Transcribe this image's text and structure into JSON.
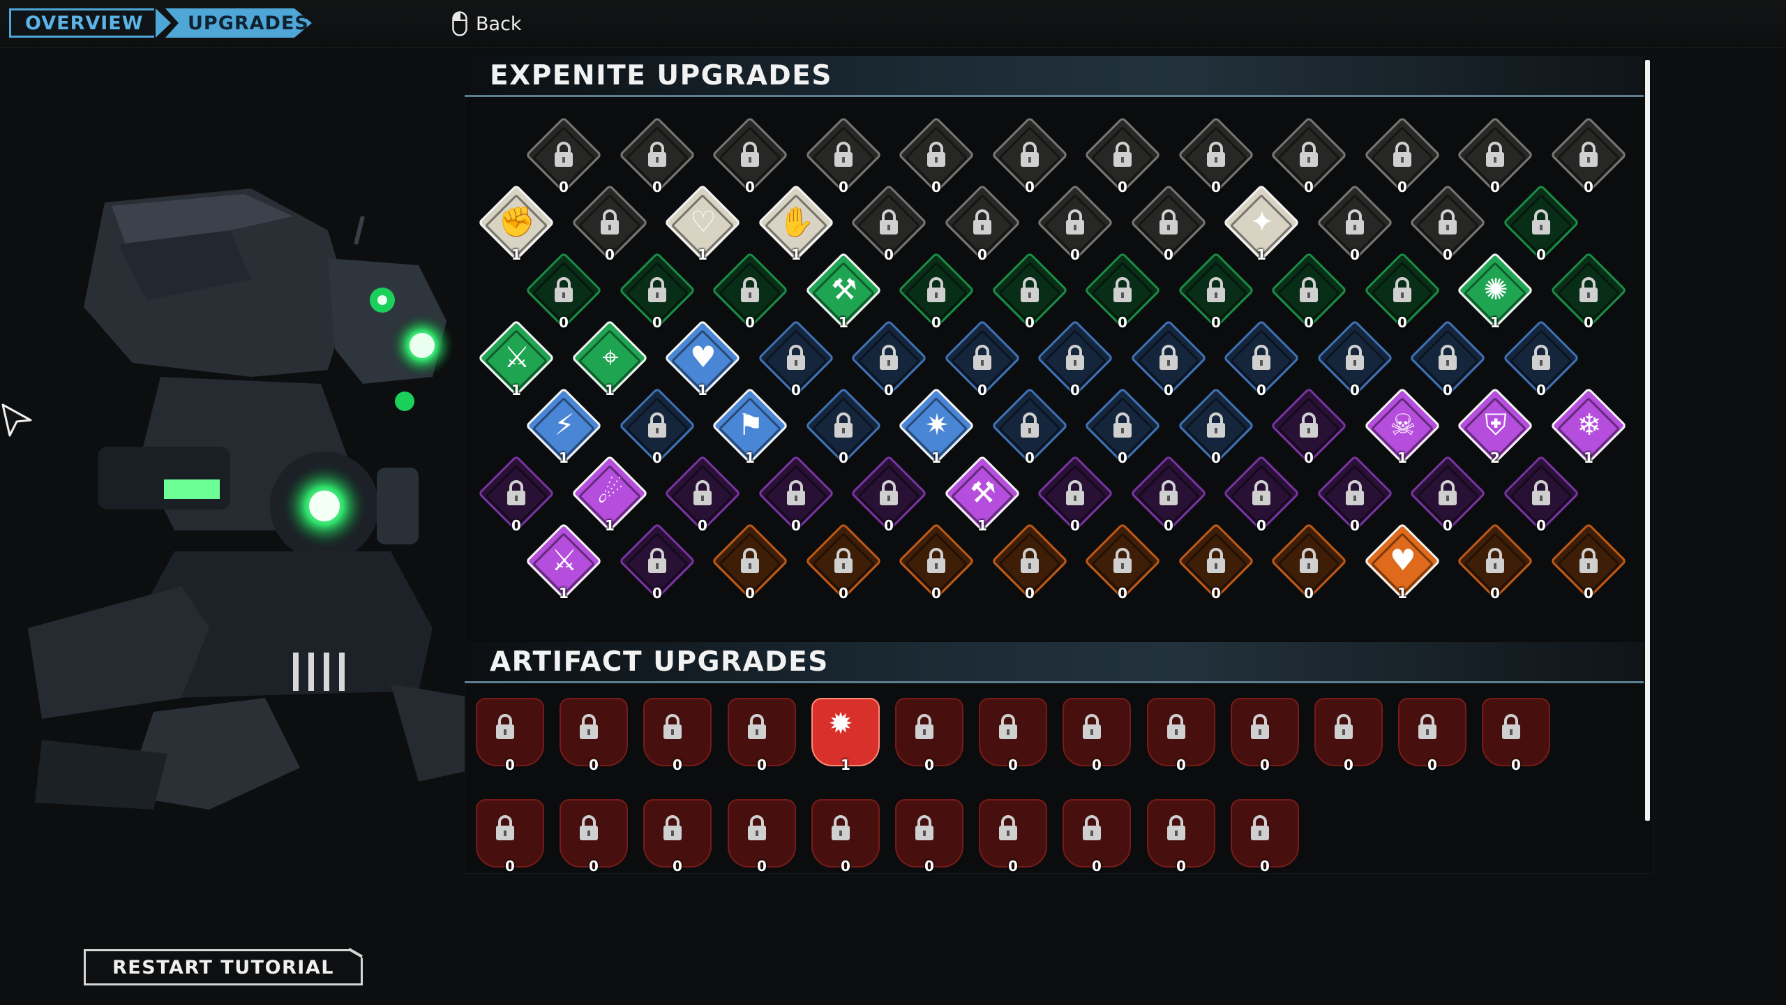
{
  "breadcrumb": {
    "overview": "OVERVIEW",
    "upgrades": "UPGRADES"
  },
  "back": {
    "icon": "mouse-icon",
    "label": "Back"
  },
  "sections": {
    "expenite_title": "EXPENITE UPGRADES",
    "artifact_title": "ARTIFACT UPGRADES"
  },
  "restart_label": "RESTART TUTORIAL",
  "colors": {
    "gray": "#8d8c89",
    "tan": "#d9d3c4",
    "green": "#1fa552",
    "blue": "#4a86d6",
    "purple": "#8e3dbf",
    "purple_bright": "#b54ddd",
    "orange": "#e06a1b",
    "red": "#d8312c"
  },
  "expenite_rows": [
    [
      {
        "c": "gray",
        "n": "0"
      },
      {
        "c": "gray",
        "n": "0"
      },
      {
        "c": "gray",
        "n": "0"
      },
      {
        "c": "gray",
        "n": "0"
      },
      {
        "c": "gray",
        "n": "0"
      },
      {
        "c": "gray",
        "n": "0"
      },
      {
        "c": "gray",
        "n": "0"
      },
      {
        "c": "gray",
        "n": "0"
      },
      {
        "c": "gray",
        "n": "0"
      },
      {
        "c": "gray",
        "n": "0"
      },
      {
        "c": "gray",
        "n": "0"
      },
      {
        "c": "gray",
        "n": "0"
      }
    ],
    [
      {
        "c": "tan",
        "n": "1",
        "on": true,
        "g": "✊"
      },
      {
        "c": "gray",
        "n": "0"
      },
      {
        "c": "tan",
        "n": "1",
        "on": true,
        "g": "♡"
      },
      {
        "c": "tan",
        "n": "1",
        "on": true,
        "g": "✋"
      },
      {
        "c": "gray",
        "n": "0"
      },
      {
        "c": "gray",
        "n": "0"
      },
      {
        "c": "gray",
        "n": "0"
      },
      {
        "c": "gray",
        "n": "0"
      },
      {
        "c": "tan",
        "n": "1",
        "on": true,
        "g": "✦"
      },
      {
        "c": "gray",
        "n": "0"
      },
      {
        "c": "gray",
        "n": "0"
      },
      {
        "c": "green",
        "n": "0"
      }
    ],
    [
      {
        "c": "green",
        "n": "0"
      },
      {
        "c": "green",
        "n": "0"
      },
      {
        "c": "green",
        "n": "0"
      },
      {
        "c": "green",
        "n": "1",
        "on": true,
        "g": "⚒"
      },
      {
        "c": "green",
        "n": "0"
      },
      {
        "c": "green",
        "n": "0"
      },
      {
        "c": "green",
        "n": "0"
      },
      {
        "c": "green",
        "n": "0"
      },
      {
        "c": "green",
        "n": "0"
      },
      {
        "c": "green",
        "n": "0"
      },
      {
        "c": "green",
        "n": "1",
        "on": true,
        "g": "✺"
      },
      {
        "c": "green",
        "n": "0"
      }
    ],
    [
      {
        "c": "green",
        "n": "1",
        "on": true,
        "g": "⚔"
      },
      {
        "c": "green",
        "n": "1",
        "on": true,
        "g": "⌖"
      },
      {
        "c": "blue",
        "n": "1",
        "on": true,
        "g": "♥"
      },
      {
        "c": "blue",
        "n": "0"
      },
      {
        "c": "blue",
        "n": "0"
      },
      {
        "c": "blue",
        "n": "0"
      },
      {
        "c": "blue",
        "n": "0"
      },
      {
        "c": "blue",
        "n": "0"
      },
      {
        "c": "blue",
        "n": "0"
      },
      {
        "c": "blue",
        "n": "0"
      },
      {
        "c": "blue",
        "n": "0"
      },
      {
        "c": "blue",
        "n": "0"
      }
    ],
    [
      {
        "c": "blue",
        "n": "1",
        "on": true,
        "g": "⚡"
      },
      {
        "c": "blue",
        "n": "0"
      },
      {
        "c": "blue",
        "n": "1",
        "on": true,
        "g": "⚑"
      },
      {
        "c": "blue",
        "n": "0"
      },
      {
        "c": "blue",
        "n": "1",
        "on": true,
        "g": "✷"
      },
      {
        "c": "blue",
        "n": "0"
      },
      {
        "c": "blue",
        "n": "0"
      },
      {
        "c": "blue",
        "n": "0"
      },
      {
        "c": "purple",
        "n": "0"
      },
      {
        "c": "purple_bright",
        "n": "1",
        "on": true,
        "g": "☠"
      },
      {
        "c": "purple_bright",
        "n": "2",
        "on": true,
        "g": "⛨"
      },
      {
        "c": "purple_bright",
        "n": "1",
        "on": true,
        "g": "❄"
      }
    ],
    [
      {
        "c": "purple",
        "n": "0"
      },
      {
        "c": "purple_bright",
        "n": "1",
        "on": true,
        "g": "☄"
      },
      {
        "c": "purple",
        "n": "0"
      },
      {
        "c": "purple",
        "n": "0"
      },
      {
        "c": "purple",
        "n": "0"
      },
      {
        "c": "purple_bright",
        "n": "1",
        "on": true,
        "g": "⚒"
      },
      {
        "c": "purple",
        "n": "0"
      },
      {
        "c": "purple",
        "n": "0"
      },
      {
        "c": "purple",
        "n": "0"
      },
      {
        "c": "purple",
        "n": "0"
      },
      {
        "c": "purple",
        "n": "0"
      },
      {
        "c": "purple",
        "n": "0"
      }
    ],
    [
      {
        "c": "purple_bright",
        "n": "1",
        "on": true,
        "g": "⚔"
      },
      {
        "c": "purple",
        "n": "0"
      },
      {
        "c": "orange",
        "n": "0"
      },
      {
        "c": "orange",
        "n": "0"
      },
      {
        "c": "orange",
        "n": "0"
      },
      {
        "c": "orange",
        "n": "0"
      },
      {
        "c": "orange",
        "n": "0"
      },
      {
        "c": "orange",
        "n": "0"
      },
      {
        "c": "orange",
        "n": "0"
      },
      {
        "c": "orange",
        "n": "1",
        "on": true,
        "g": "♥"
      },
      {
        "c": "orange",
        "n": "0"
      },
      {
        "c": "orange",
        "n": "0"
      }
    ]
  ],
  "artifact_rows": [
    [
      {
        "n": "0"
      },
      {
        "n": "0"
      },
      {
        "n": "0"
      },
      {
        "n": "0"
      },
      {
        "n": "1",
        "on": true,
        "g": "✹"
      },
      {
        "n": "0"
      },
      {
        "n": "0"
      },
      {
        "n": "0"
      },
      {
        "n": "0"
      },
      {
        "n": "0"
      },
      {
        "n": "0"
      },
      {
        "n": "0"
      },
      {
        "n": "0"
      }
    ],
    [
      {
        "n": "0"
      },
      {
        "n": "0"
      },
      {
        "n": "0"
      },
      {
        "n": "0"
      },
      {
        "n": "0"
      },
      {
        "n": "0"
      },
      {
        "n": "0"
      },
      {
        "n": "0"
      },
      {
        "n": "0"
      },
      {
        "n": "0"
      }
    ]
  ]
}
